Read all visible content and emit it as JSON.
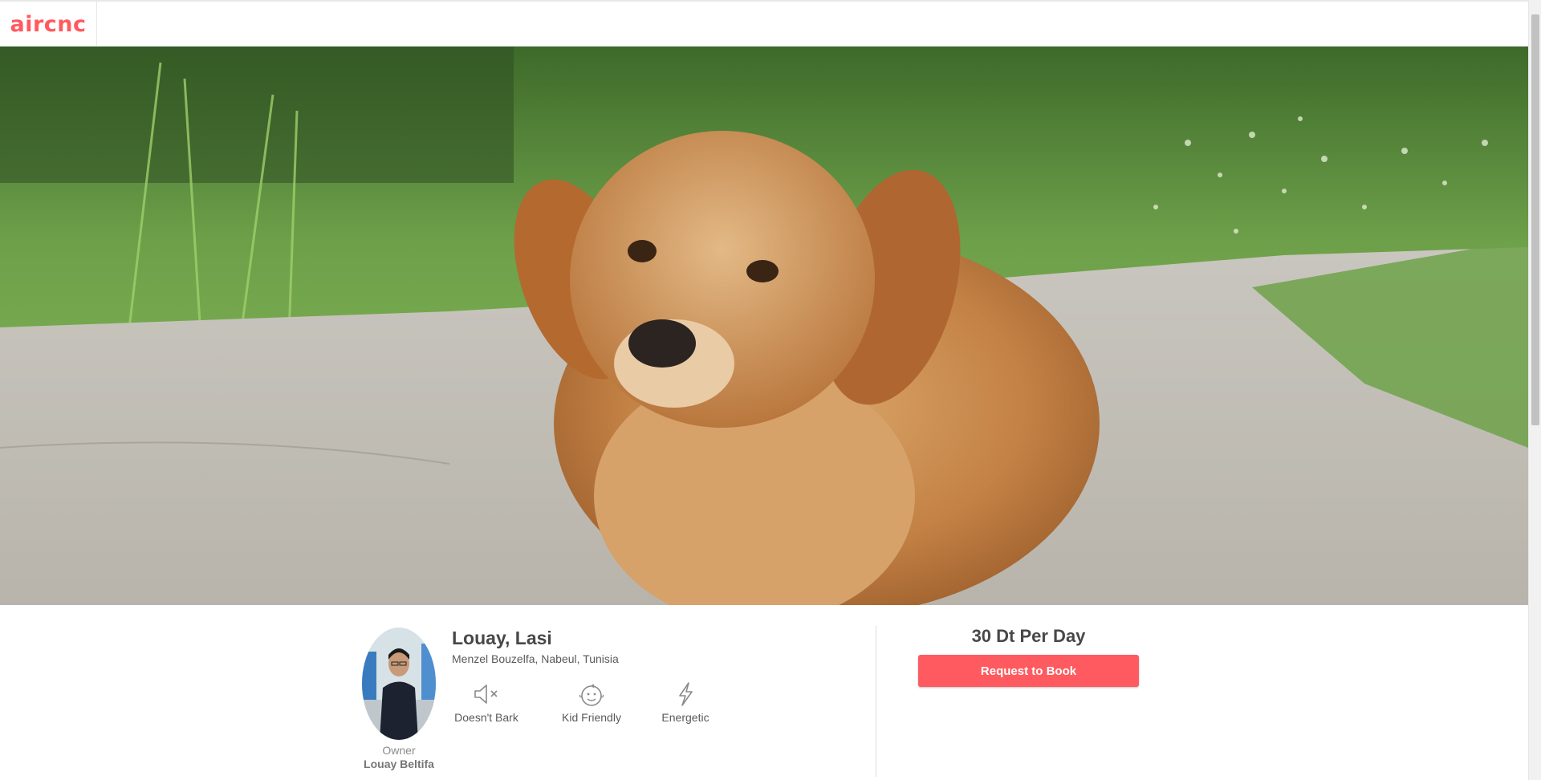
{
  "nav": {
    "logo": "aircnc"
  },
  "colors": {
    "brand": "#ff5a5f"
  },
  "listing": {
    "title": "Louay, Lasi",
    "location": "Menzel Bouzelfa, Nabeul, Tunisia",
    "features": [
      {
        "icon": "muted-speaker-icon",
        "label": "Doesn't Bark"
      },
      {
        "icon": "baby-face-icon",
        "label": "Kid Friendly"
      },
      {
        "icon": "lightning-bolt-icon",
        "label": "Energetic"
      }
    ]
  },
  "owner": {
    "label": "Owner",
    "name": "Louay Beltifa"
  },
  "booking": {
    "price": "30 Dt Per Day",
    "button": "Request to Book"
  }
}
